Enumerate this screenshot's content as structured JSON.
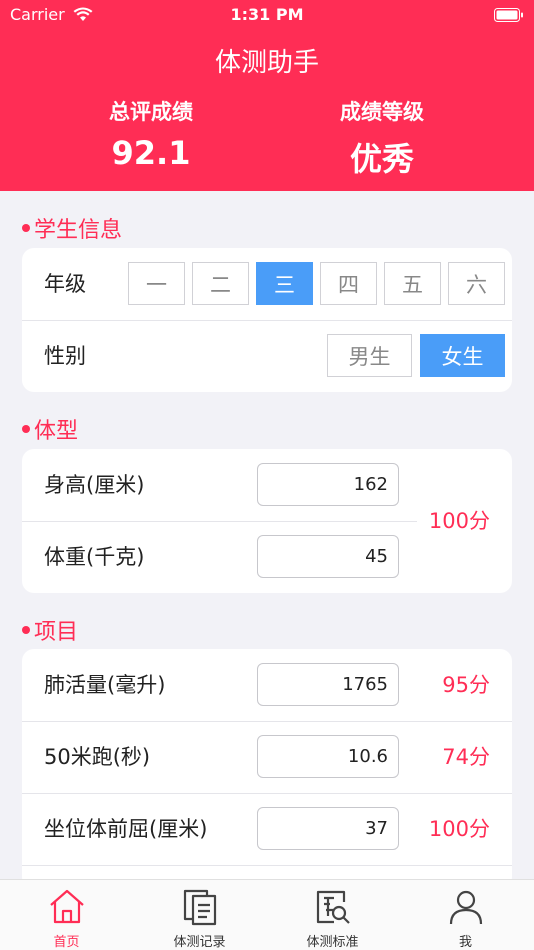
{
  "status_bar": {
    "carrier": "Carrier",
    "time": "1:31 PM"
  },
  "header": {
    "title": "体测助手",
    "total_score_label": "总评成绩",
    "total_score": "92.1",
    "grade_level_label": "成绩等级",
    "grade_level": "优秀"
  },
  "student_info": {
    "section_title": "学生信息",
    "grade_label": "年级",
    "grades": [
      "一",
      "二",
      "三",
      "四",
      "五",
      "六"
    ],
    "selected_grade_index": 2,
    "gender_label": "性别",
    "genders": [
      "男生",
      "女生"
    ],
    "selected_gender_index": 1
  },
  "body_type": {
    "section_title": "体型",
    "height_label": "身高(厘米)",
    "height_value": "162",
    "weight_label": "体重(千克)",
    "weight_value": "45",
    "bmi_score": "100分"
  },
  "items": {
    "section_title": "项目",
    "rows": [
      {
        "label": "肺活量(毫升)",
        "value": "1765",
        "score": "95分"
      },
      {
        "label": "50米跑(秒)",
        "value": "10.6",
        "score": "74分"
      },
      {
        "label": "坐位体前屈(厘米)",
        "value": "37",
        "score": "100分"
      }
    ]
  },
  "tabbar": {
    "tabs": [
      {
        "label": "首页",
        "icon": "home-icon"
      },
      {
        "label": "体测记录",
        "icon": "records-icon"
      },
      {
        "label": "体测标准",
        "icon": "standards-icon"
      },
      {
        "label": "我",
        "icon": "profile-icon"
      }
    ],
    "active_index": 0
  },
  "colors": {
    "brand": "#ff2d55",
    "selected": "#4a9df8"
  }
}
